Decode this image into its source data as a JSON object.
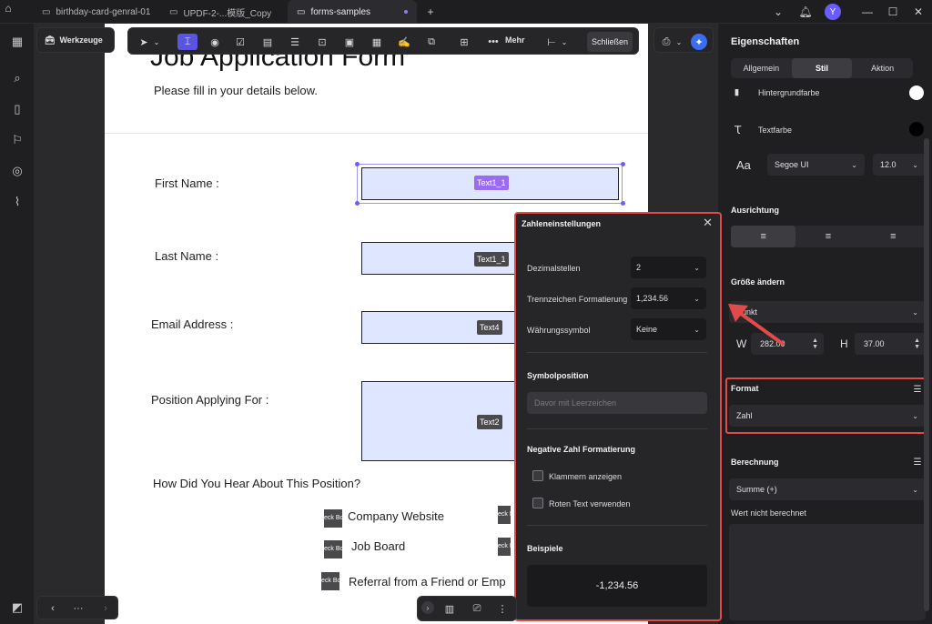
{
  "tabs": [
    {
      "label": "birthday-card-genral-01"
    },
    {
      "label": "UPDF-2-...模版_Copy"
    },
    {
      "label": "forms-samples"
    }
  ],
  "window": {
    "avatar_letter": "Y"
  },
  "toolbar": {
    "werkzeuge_label": "Werkzeuge",
    "mehr_label": "Mehr",
    "close_label": "Schließen"
  },
  "form": {
    "title": "Job Application Form",
    "subtitle": "Please fill in your details below.",
    "fields": [
      {
        "label": "First Name :",
        "tag": "Text1_1"
      },
      {
        "label": "Last Name :",
        "tag": "Text1_1"
      },
      {
        "label": "Email Address :",
        "tag": "Text4"
      },
      {
        "label": "Position Applying For :",
        "tag": "Text2"
      }
    ],
    "question": "How Did You Hear About This Position?",
    "checkbox_tag": "eck Bo",
    "options": [
      "Company Website",
      "Job Board",
      "Referral from a Friend or Emp"
    ]
  },
  "popup": {
    "title": "Zahleneinstellungen",
    "decimals_label": "Dezimalstellen",
    "decimals_value": "2",
    "separator_label": "Trennzeichen Formatierung",
    "separator_value": "1,234.56",
    "currency_label": "Währungssymbol",
    "currency_value": "Keine",
    "symbol_position_title": "Symbolposition",
    "symbol_position_value": "Davor mit Leerzeichen",
    "negative_title": "Negative Zahl Formatierung",
    "brackets_label": "Klammern anzeigen",
    "red_text_label": "Roten Text verwenden",
    "examples_title": "Beispiele",
    "example_value": "-1,234.56"
  },
  "panel": {
    "title": "Eigenschaften",
    "tabs": [
      "Allgemein",
      "Stil",
      "Aktion"
    ],
    "background_label": "Hintergrundfarbe",
    "text_color_label": "Textfarbe",
    "font_value": "Segoe UI",
    "font_size_value": "12.0",
    "alignment_title": "Ausrichtung",
    "resize_title": "Größe ändern",
    "unit_value": "Punkt",
    "w_label": "W",
    "w_value": "282.00",
    "h_label": "H",
    "h_value": "37.00",
    "format_title": "Format",
    "format_value": "Zahl",
    "calc_title": "Berechnung",
    "calc_value": "Summe (+)",
    "calc_note": "Wert nicht berechnet",
    "text_color_swatch": "#000000",
    "bg_color_swatch": "#ffffff",
    "accent": "#5a55e0",
    "highlight": "#e24a4a"
  }
}
